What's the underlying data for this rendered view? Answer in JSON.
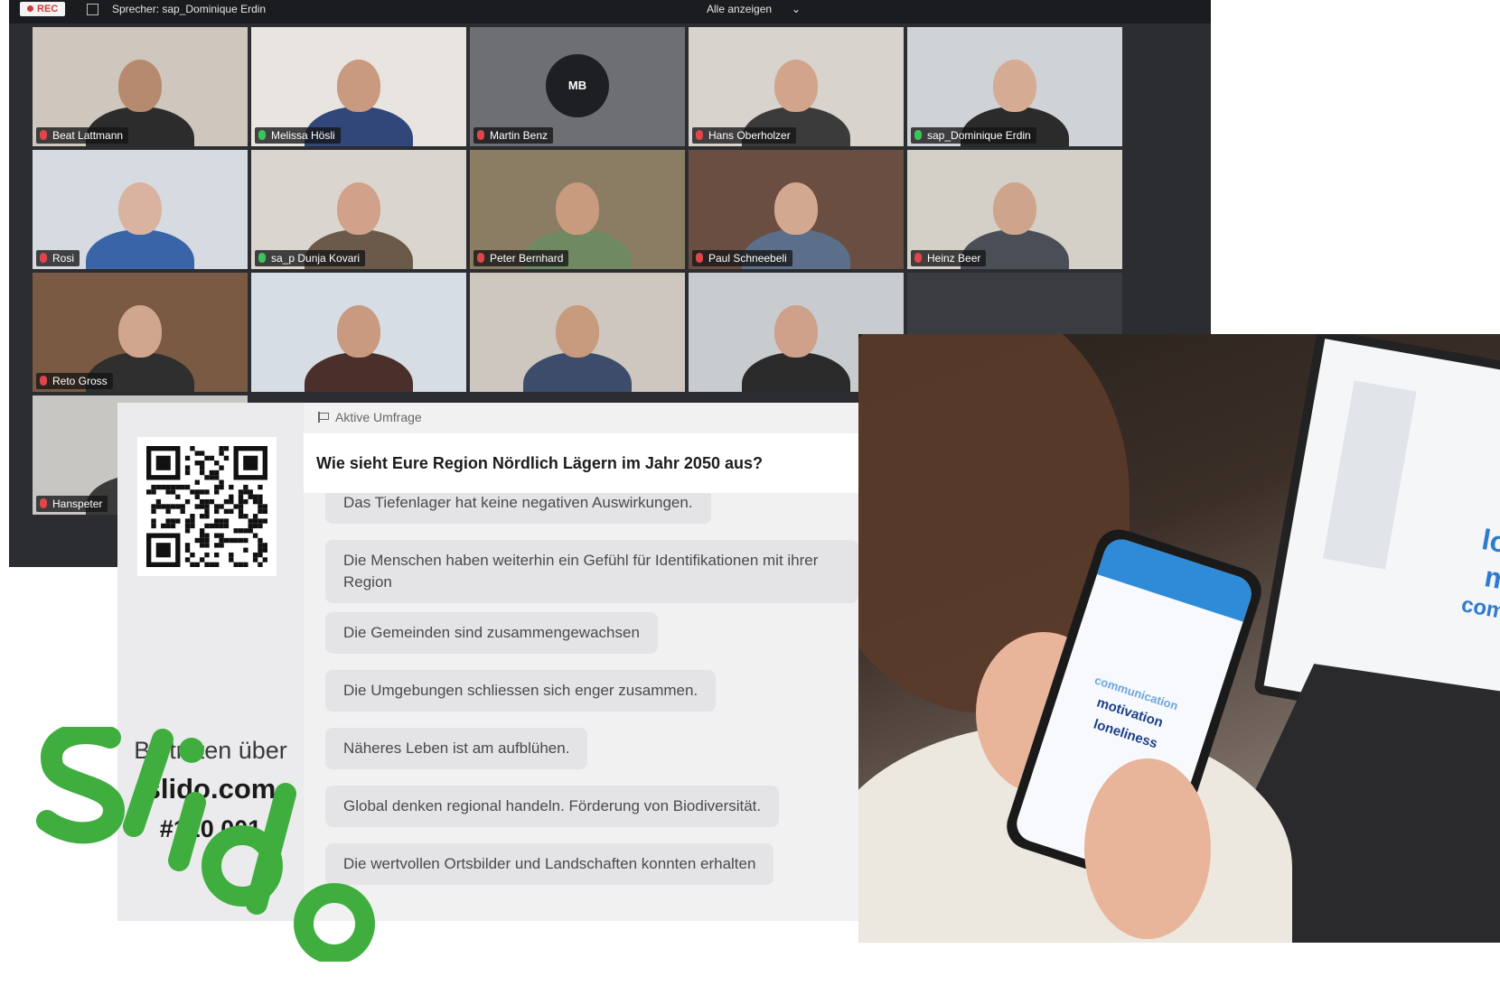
{
  "zoom": {
    "rec_label": "REC",
    "speaker_label": "Sprecher: sap_Dominique Erdin",
    "show_all_label": "Alle anzeigen",
    "tiles": [
      {
        "name": "Beat Lattmann",
        "mic": "muted",
        "bg": "#cfc7bd",
        "skin": "#b58a6e",
        "shirt": "#2c2c2c"
      },
      {
        "name": "Melissa Hösli",
        "mic": "on",
        "bg": "#e8e4df",
        "skin": "#c99a80",
        "shirt": "#31477a"
      },
      {
        "name": "Martin Benz",
        "mic": "muted",
        "bg": "#6d6f72",
        "initials": "MB"
      },
      {
        "name": "Hans Oberholzer",
        "mic": "muted",
        "bg": "#d8d3cc",
        "skin": "#d2a48c",
        "shirt": "#3b3b3b"
      },
      {
        "name": "sap_Dominique Erdin",
        "mic": "on",
        "bg": "#cfd2d6",
        "skin": "#d6ab93",
        "shirt": "#2b2b2b"
      },
      {
        "name": "Rosi",
        "mic": "muted",
        "bg": "#d6dbe1",
        "skin": "#d9b3a0",
        "shirt": "#3a64a8"
      },
      {
        "name": "sa_p Dunja Kovari",
        "mic": "on",
        "bg": "#dad6cf",
        "skin": "#d2a18a",
        "shirt": "#6b5a4a"
      },
      {
        "name": "Peter Bernhard",
        "mic": "muted",
        "bg": "#8a7d63",
        "skin": "#c89a7e",
        "shirt": "#6f8a62"
      },
      {
        "name": "Paul Schneebeli",
        "mic": "muted",
        "bg": "#6a4e42",
        "skin": "#d3a891",
        "shirt": "#5b6f8a"
      },
      {
        "name": "Heinz Beer",
        "mic": "muted",
        "bg": "#d4d0c8",
        "skin": "#cfa48c",
        "shirt": "#4a4f57"
      },
      {
        "name": "Reto Gross",
        "mic": "muted",
        "bg": "#7a5a42",
        "skin": "#d0a68e",
        "shirt": "#2f2f2f"
      },
      {
        "name": "",
        "mic": "muted",
        "bg": "#d7dde4",
        "skin": "#c99a7f",
        "shirt": "#4b2f2a"
      },
      {
        "name": "",
        "mic": "muted",
        "bg": "#cdc7bf",
        "skin": "#c89a7e",
        "shirt": "#3c4c6a"
      },
      {
        "name": "",
        "mic": "muted",
        "bg": "#c9ccce",
        "skin": "#cfa08a",
        "shirt": "#2a2a2a"
      },
      {
        "name": "Hanspeter",
        "mic": "muted",
        "bg": "#c8c6c2",
        "skin": "#d1a68c",
        "shirt": "#3a3a3a"
      }
    ]
  },
  "slido": {
    "active_poll_label": "Aktive Umfrage",
    "join_label": "Beitreten über",
    "join_url": "slido.com",
    "join_code": "#120 001",
    "question": "Wie sieht Eure Region Nördlich Lägern im Jahr 2050 aus?",
    "responses": [
      "Das Tiefenlager hat keine negativen Auswirkungen.",
      "Die Menschen haben weiterhin ein Gefühl für Identifikationen mit ihrer Region",
      "Die Gemeinden sind zusammengewachsen",
      "Die Umgebungen schliessen sich enger zusammen.",
      "Näheres Leben ist am aufblühen.",
      "Global denken regional handeln. Förderung von Biodiversität.",
      "Die wertvollen Ortsbilder und Landschaften konnten erhalten"
    ]
  },
  "photo": {
    "phone_words": [
      "communication",
      "motivation",
      "loneliness"
    ],
    "laptop_words": [
      "lo",
      "m",
      "com"
    ]
  },
  "colors": {
    "slido_green": "#3fae3f",
    "zoom_bg": "#2b2d31"
  }
}
